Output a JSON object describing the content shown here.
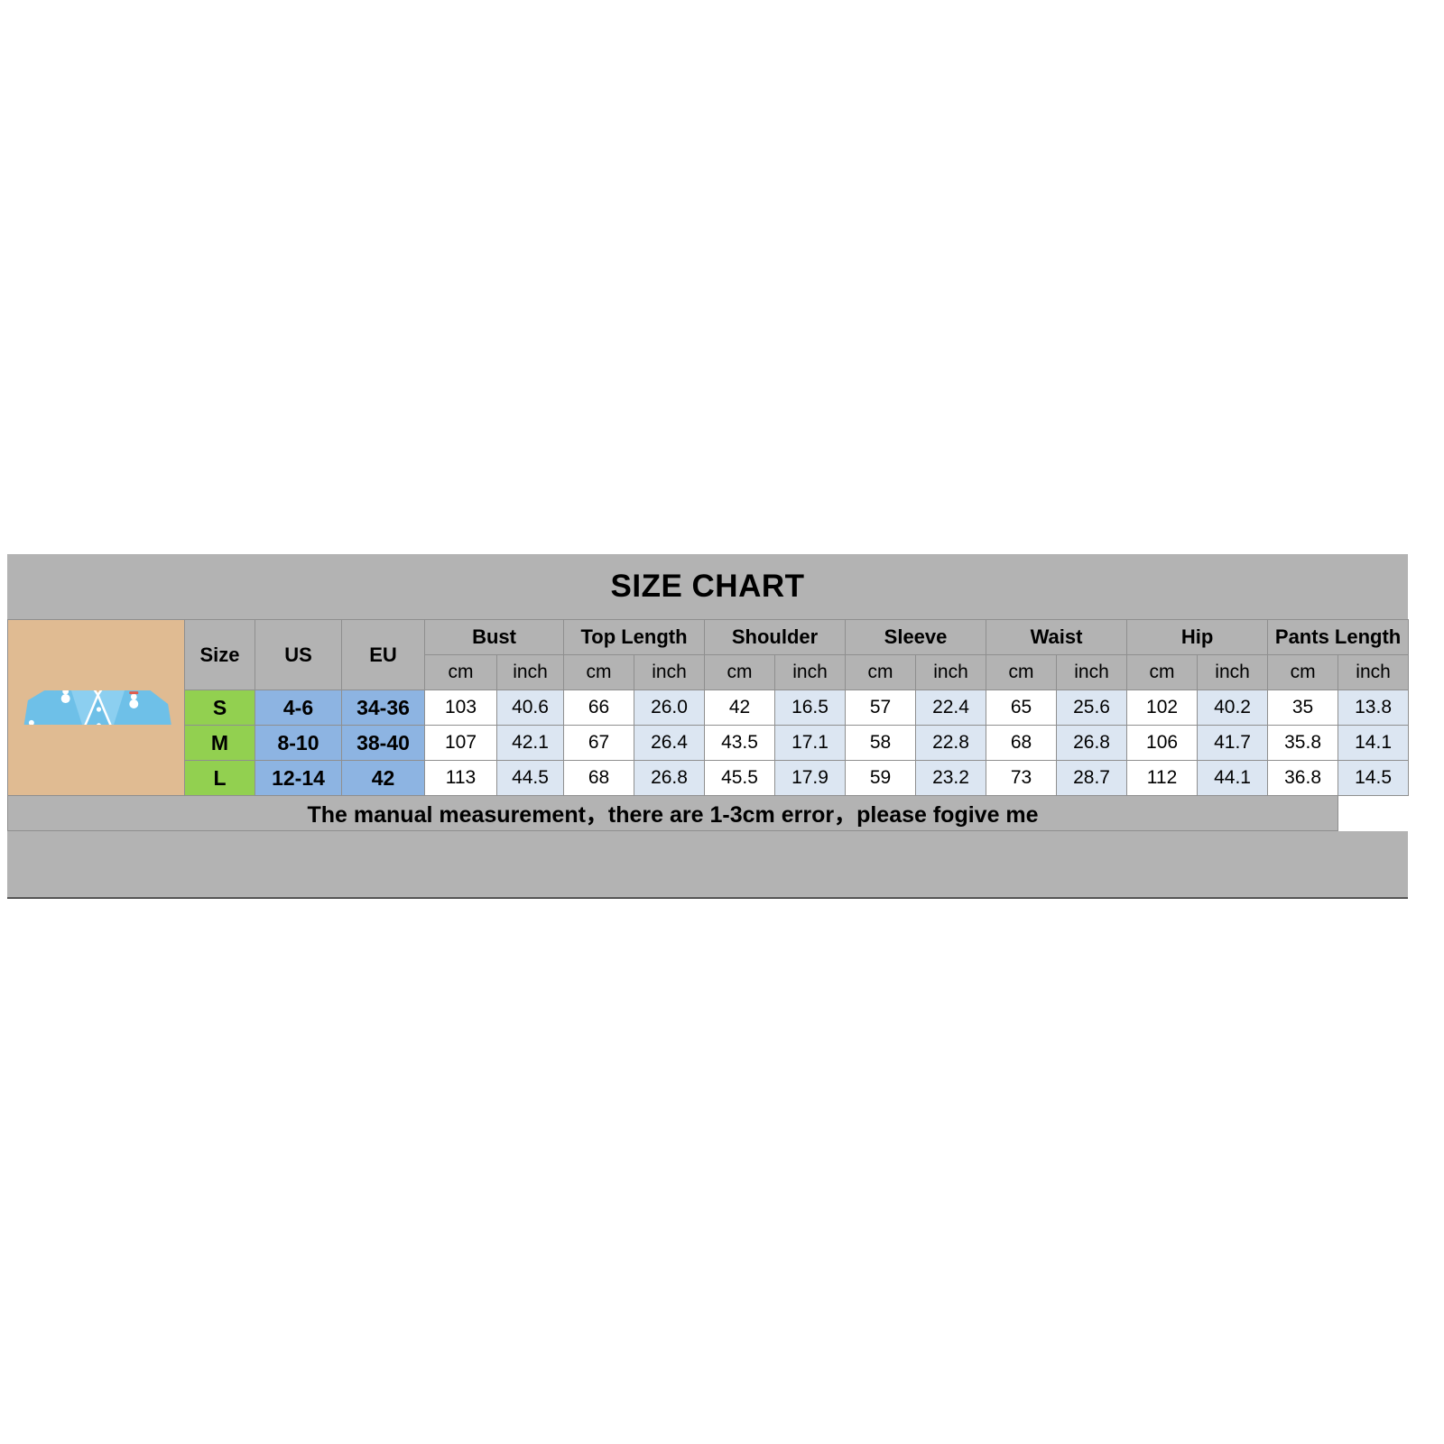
{
  "title": "SIZE CHART",
  "note": "The manual measurement，there are 1-3cm error，please fogive me",
  "columns": {
    "size": "Size",
    "us": "US",
    "eu": "EU",
    "groups": [
      {
        "label": "Bust",
        "units": [
          "cm",
          "inch"
        ]
      },
      {
        "label": "Top Length",
        "units": [
          "cm",
          "inch"
        ]
      },
      {
        "label": "Shoulder",
        "units": [
          "cm",
          "inch"
        ]
      },
      {
        "label": "Sleeve",
        "units": [
          "cm",
          "inch"
        ]
      },
      {
        "label": "Waist",
        "units": [
          "cm",
          "inch"
        ]
      },
      {
        "label": "Hip",
        "units": [
          "cm",
          "inch"
        ]
      },
      {
        "label": "Pants Length",
        "units": [
          "cm",
          "inch"
        ]
      }
    ]
  },
  "rows": [
    {
      "size": "S",
      "us": "4-6",
      "eu": "34-36",
      "bust_cm": "103",
      "bust_inch": "40.6",
      "top_cm": "66",
      "top_inch": "26.0",
      "shoulder_cm": "42",
      "shoulder_inch": "16.5",
      "sleeve_cm": "57",
      "sleeve_inch": "22.4",
      "waist_cm": "65",
      "waist_inch": "25.6",
      "hip_cm": "102",
      "hip_inch": "40.2",
      "pants_cm": "35",
      "pants_inch": "13.8"
    },
    {
      "size": "M",
      "us": "8-10",
      "eu": "38-40",
      "bust_cm": "107",
      "bust_inch": "42.1",
      "top_cm": "67",
      "top_inch": "26.4",
      "shoulder_cm": "43.5",
      "shoulder_inch": "17.1",
      "sleeve_cm": "58",
      "sleeve_inch": "22.8",
      "waist_cm": "68",
      "waist_inch": "26.8",
      "hip_cm": "106",
      "hip_inch": "41.7",
      "pants_cm": "35.8",
      "pants_inch": "14.1"
    },
    {
      "size": "L",
      "us": "12-14",
      "eu": "42",
      "bust_cm": "113",
      "bust_inch": "44.5",
      "top_cm": "68",
      "top_inch": "26.8",
      "shoulder_cm": "45.5",
      "shoulder_inch": "17.9",
      "sleeve_cm": "59",
      "sleeve_inch": "23.2",
      "waist_cm": "73",
      "waist_inch": "28.7",
      "hip_cm": "112",
      "hip_inch": "44.1",
      "pants_cm": "36.8",
      "pants_inch": "14.5"
    }
  ],
  "photo": {
    "alt_name": "model-wearing-blue-snowman-pajama-set",
    "colors": {
      "background": "#e0bb92",
      "fabric": "#6ec0e8",
      "skin": "#e8b88f",
      "hair": "#3b2a20",
      "trim": "#ffffff"
    }
  },
  "palette": {
    "frame_grey": "#b3b3b3",
    "size_green": "#92d050",
    "us_eu_blue": "#8db4e2",
    "inch_blue": "#dce6f2",
    "border": "#8f8f8f"
  }
}
